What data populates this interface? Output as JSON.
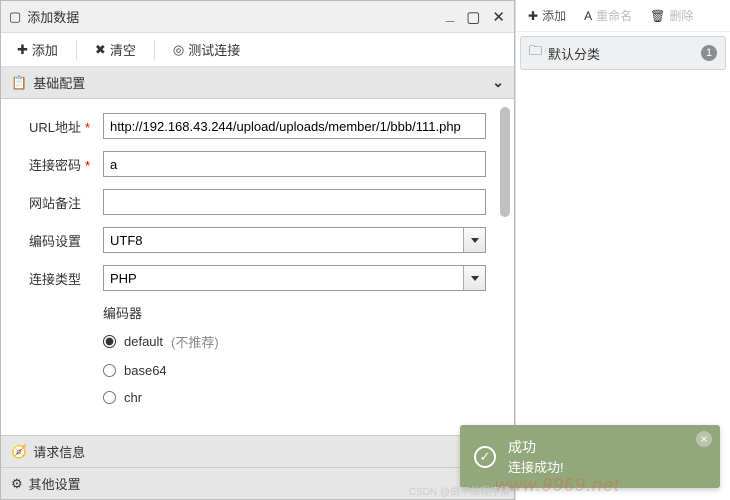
{
  "dialog": {
    "title": "添加数据",
    "toolbar": {
      "add": "添加",
      "clear": "清空",
      "test": "测试连接"
    },
    "sections": {
      "basic": "基础配置",
      "request": "请求信息",
      "other": "其他设置"
    },
    "form": {
      "url": {
        "label": "URL地址",
        "value": "http://192.168.43.244/upload/uploads/member/1/bbb/111.php"
      },
      "password": {
        "label": "连接密码",
        "value": "a"
      },
      "note": {
        "label": "网站备注",
        "value": ""
      },
      "encoding": {
        "label": "编码设置",
        "value": "UTF8"
      },
      "conn_type": {
        "label": "连接类型",
        "value": "PHP"
      },
      "encoder": {
        "title": "编码器",
        "options": {
          "default": "default",
          "default_hint": "(不推荐)",
          "base64": "base64",
          "chr": "chr"
        }
      }
    }
  },
  "sidebar": {
    "toolbar": {
      "add": "添加",
      "rename": "重命名",
      "delete": "删除"
    },
    "category": "默认分类",
    "count": "1"
  },
  "toast": {
    "title": "成功",
    "message": "连接成功!"
  },
  "watermark": "www.9969.net",
  "csdn": "CSDN @做不做程序猿"
}
